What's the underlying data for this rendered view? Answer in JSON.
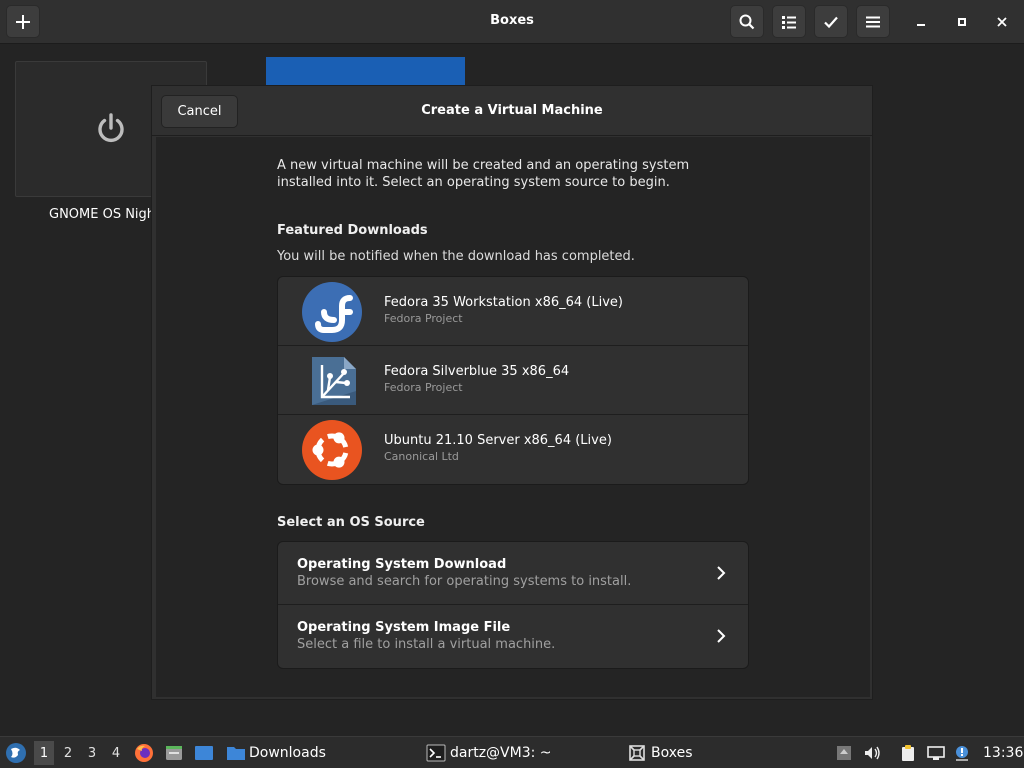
{
  "window": {
    "title": "Boxes"
  },
  "vm": {
    "label": "GNOME OS Nigh"
  },
  "dialog": {
    "cancel_label": "Cancel",
    "title": "Create a Virtual Machine",
    "intro": "A new virtual machine will be created and an operating system installed into it. Select an operating system source to begin.",
    "featured_heading": "Featured Downloads",
    "featured_note": "You will be notified when the download has completed.",
    "featured": [
      {
        "name": "Fedora 35 Workstation x86_64 (Live)",
        "vendor": "Fedora Project",
        "icon": "fedora-logo-icon"
      },
      {
        "name": "Fedora Silverblue 35 x86_64",
        "vendor": "Fedora Project",
        "icon": "fedora-silverblue-logo-icon"
      },
      {
        "name": "Ubuntu 21.10 Server x86_64 (Live)",
        "vendor": "Canonical Ltd",
        "icon": "ubuntu-logo-icon"
      }
    ],
    "source_heading": "Select an OS Source",
    "sources": [
      {
        "title": "Operating System Download",
        "subtitle": "Browse and search for operating systems to install."
      },
      {
        "title": "Operating System Image File",
        "subtitle": "Select a file to install a virtual machine."
      }
    ]
  },
  "taskbar": {
    "workspaces": [
      "1",
      "2",
      "3",
      "4"
    ],
    "apps": [
      {
        "label": "Downloads",
        "icon": "folder-icon"
      },
      {
        "label": "dartz@VM3: ~",
        "icon": "terminal-icon"
      },
      {
        "label": "Boxes",
        "icon": "boxes-icon"
      }
    ],
    "clock": "13:36"
  },
  "colors": {
    "accent": "#1a5fb4",
    "fedora_blue": "#3c6eb4",
    "silverblue": "#4a6f95",
    "ubuntu_orange": "#e95420"
  }
}
